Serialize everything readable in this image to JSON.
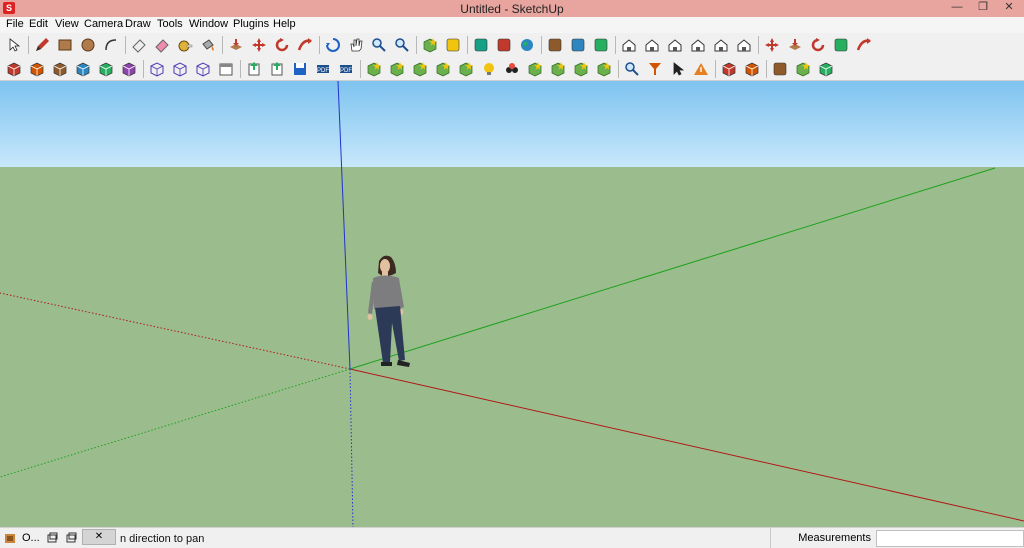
{
  "window": {
    "title": "Untitled - SketchUp",
    "app_icon": "sketchup-logo-icon",
    "controls": [
      "minimize-icon",
      "restore-icon",
      "close-icon"
    ]
  },
  "menu": [
    "File",
    "Edit",
    "View",
    "Camera",
    "Draw",
    "Tools",
    "Window",
    "Plugins",
    "Help"
  ],
  "toolbar_row1": [
    "select-arrow-icon",
    "pencil-line-icon",
    "rectangle-icon",
    "circle-icon",
    "arc-icon",
    "eraser-icon",
    "eraser-pink-icon",
    "tape-measure-icon",
    "paint-bucket-icon",
    "push-pull-icon",
    "move-icon",
    "rotate-icon",
    "follow-me-icon",
    "orbit-icon",
    "pan-hand-icon",
    "zoom-icon",
    "zoom-extents-icon",
    "add-location-icon",
    "terrain-icon",
    "get-models-icon",
    "share-model-icon",
    "google-earth-icon",
    "component-get-icon",
    "component-share-icon",
    "extension-icon",
    "iso-view-icon",
    "top-view-icon",
    "front-view-icon",
    "right-view-icon",
    "back-view-icon",
    "left-view-icon",
    "move-red-icon",
    "push-pull-red-icon",
    "rotate-red-icon",
    "scale-icon",
    "follow-me-red-icon"
  ],
  "toolbar_row2": [
    "box-solid-icon",
    "box-textured-icon",
    "box-hidden-icon",
    "box-pink-icon",
    "box-shaded-icon",
    "box-xray-icon",
    "xray-icon",
    "backedges-icon",
    "wireframe-icon",
    "calendar-icon",
    "export-icon",
    "import-icon",
    "save-icon",
    "pdf-icon",
    "pdf-export-icon",
    "section-icon",
    "section-add-icon",
    "shadow-icon",
    "add-component-icon",
    "grid-icon",
    "light-icon",
    "glasses-icon",
    "network-icon",
    "stars-icon",
    "layers-icon",
    "outliner-icon",
    "zoom-window-icon",
    "filter-icon",
    "cursor-icon",
    "warning-icon",
    "cube-blue-icon",
    "help-cube-icon",
    "walk-icon",
    "section-plane-icon",
    "axes-box-icon"
  ],
  "status": {
    "text": "n direction to pan",
    "left_icons": [
      "geo-location-icon",
      "credits-icon",
      "instructor-icon"
    ],
    "model_info_label": "O...",
    "measurements_label": "Measurements",
    "measurements_value": ""
  },
  "colors": {
    "titlebar": "#e8a49e",
    "sky": "#7ec3ef",
    "ground": "#9bbd8d",
    "axis_red": "#b01818",
    "axis_green": "#1ca01c",
    "axis_blue": "#2233cc"
  }
}
